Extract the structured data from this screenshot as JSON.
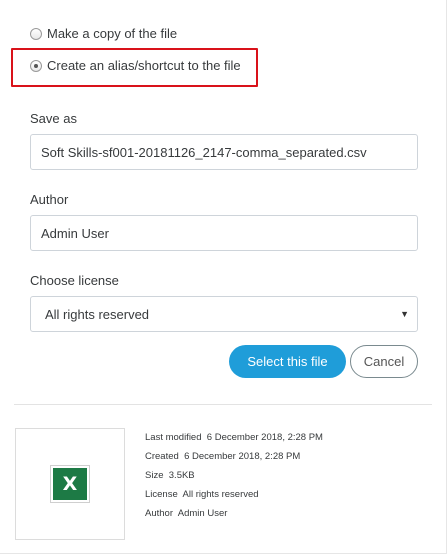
{
  "options": {
    "copy_label": "Make a copy of the file",
    "alias_label": "Create an alias/shortcut to the file",
    "selected": "alias"
  },
  "save_as": {
    "label": "Save as",
    "value": "Soft Skills-sf001-20181126_2147-comma_separated.csv"
  },
  "author": {
    "label": "Author",
    "value": "Admin User"
  },
  "license": {
    "label": "Choose license",
    "selected": "All rights reserved"
  },
  "buttons": {
    "select": "Select this file",
    "cancel": "Cancel"
  },
  "file_info": {
    "icon": "excel-file-icon",
    "icon_letter": "X",
    "last_modified_label": "Last modified",
    "last_modified": "6 December 2018, 2:28 PM",
    "created_label": "Created",
    "created": "6 December 2018, 2:28 PM",
    "size_label": "Size",
    "size": "3.5KB",
    "license_label": "License",
    "license": "All rights reserved",
    "author_label": "Author",
    "author": "Admin User"
  },
  "colors": {
    "primary_button": "#1f9dd9",
    "highlight_border": "#d9121a",
    "excel_green": "#1d7a45"
  }
}
